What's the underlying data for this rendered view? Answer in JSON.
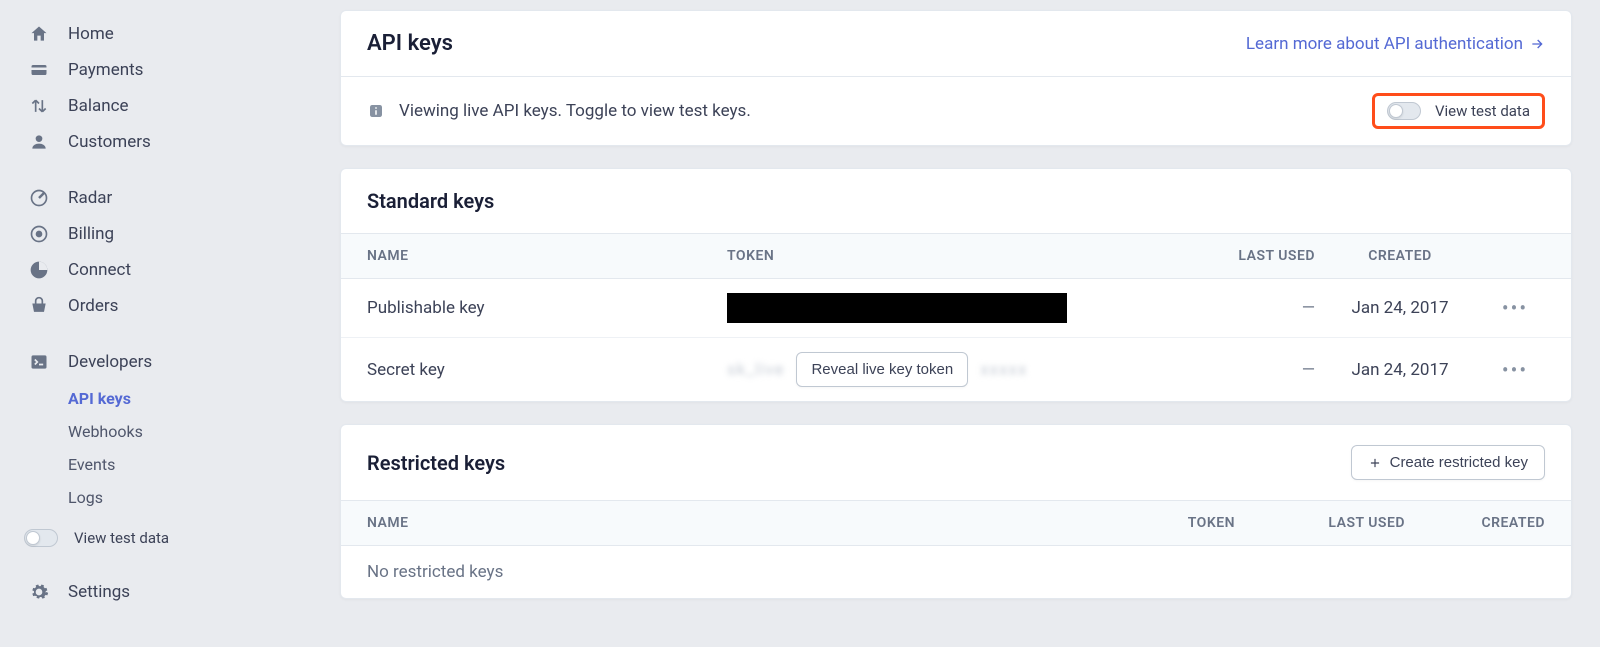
{
  "sidebar": {
    "primary": [
      {
        "label": "Home",
        "icon": "home-icon"
      },
      {
        "label": "Payments",
        "icon": "payments-icon"
      },
      {
        "label": "Balance",
        "icon": "balance-icon"
      },
      {
        "label": "Customers",
        "icon": "customers-icon"
      }
    ],
    "secondary": [
      {
        "label": "Radar",
        "icon": "radar-icon"
      },
      {
        "label": "Billing",
        "icon": "billing-icon"
      },
      {
        "label": "Connect",
        "icon": "connect-icon"
      },
      {
        "label": "Orders",
        "icon": "orders-icon"
      }
    ],
    "developers_label": "Developers",
    "dev_sub": [
      {
        "label": "API keys",
        "active": true
      },
      {
        "label": "Webhooks",
        "active": false
      },
      {
        "label": "Events",
        "active": false
      },
      {
        "label": "Logs",
        "active": false
      }
    ],
    "view_test_label": "View test data",
    "settings_label": "Settings"
  },
  "header": {
    "title": "API keys",
    "learn_more": "Learn more about API authentication"
  },
  "banner": {
    "text": "Viewing live API keys. Toggle to view test keys.",
    "toggle_label": "View test data"
  },
  "standard": {
    "title": "Standard keys",
    "columns": {
      "name": "NAME",
      "token": "TOKEN",
      "last_used": "LAST USED",
      "created": "CREATED"
    },
    "rows": [
      {
        "name": "Publishable key",
        "token_display": "redacted",
        "last_used": "—",
        "created": "Jan 24, 2017"
      },
      {
        "name": "Secret key",
        "token_display": "reveal",
        "reveal_label": "Reveal live key token",
        "last_used": "—",
        "created": "Jan 24, 2017"
      }
    ]
  },
  "restricted": {
    "title": "Restricted keys",
    "create_label": "Create restricted key",
    "columns": {
      "name": "NAME",
      "token": "TOKEN",
      "last_used": "LAST USED",
      "created": "CREATED"
    },
    "empty": "No restricted keys"
  }
}
